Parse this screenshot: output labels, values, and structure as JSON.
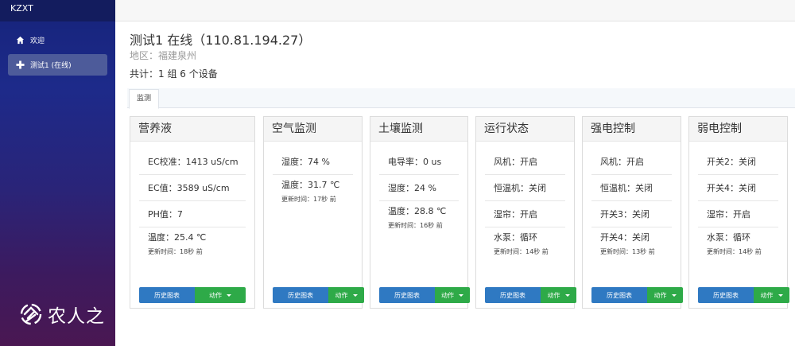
{
  "app": {
    "brand": "KZXT"
  },
  "sidebar": {
    "items": [
      {
        "label": "欢迎",
        "icon": "home-icon"
      },
      {
        "label": "测试1 (在线)",
        "icon": "plus-icon",
        "active": true
      }
    ]
  },
  "watermark": {
    "text": "农人之"
  },
  "device": {
    "title": "测试1 在线（110.81.194.27）",
    "region": "地区：福建泉州",
    "summary": "共计：1 组 6 个设备"
  },
  "tabs": [
    {
      "label": "监测",
      "active": true
    }
  ],
  "cards": [
    {
      "title": "营养液",
      "rows": [
        "EC校准：1413 uS/cm",
        "EC值：3589 uS/cm",
        "PH值：7",
        "温度：25.4 ℃"
      ],
      "updated": "更新时间：18秒 前",
      "history_label": "历史图表",
      "action_label": "动作"
    },
    {
      "title": "空气监测",
      "rows": [
        "湿度：74 %",
        "温度：31.7 ℃"
      ],
      "updated": "更新时间：17秒 前",
      "history_label": "历史图表",
      "action_label": "动作"
    },
    {
      "title": "土壤监测",
      "rows": [
        "电导率：0 us",
        "湿度：24 %",
        "温度：28.8 ℃"
      ],
      "updated": "更新时间：16秒 前",
      "history_label": "历史图表",
      "action_label": "动作"
    },
    {
      "title": "运行状态",
      "rows": [
        "风机：开启",
        "恒温机：关闭",
        "湿帘：开启",
        "水泵：循环"
      ],
      "updated": "更新时间：14秒 前",
      "history_label": "历史图表",
      "action_label": "动作"
    },
    {
      "title": "强电控制",
      "rows": [
        "风机：开启",
        "恒温机：关闭",
        "开关3：关闭",
        "开关4：关闭"
      ],
      "updated": "更新时间：13秒 前",
      "history_label": "历史图表",
      "action_label": "动作"
    },
    {
      "title": "弱电控制",
      "rows": [
        "开关2：关闭",
        "开关4：关闭",
        "湿帘：开启",
        "水泵：循环"
      ],
      "updated": "更新时间：14秒 前",
      "history_label": "历史图表",
      "action_label": "动作"
    }
  ],
  "colors": {
    "sidebar_top": "#16237a",
    "sidebar_bottom": "#4a1752",
    "history_button": "#2f79c2",
    "action_button": "#2eaa48"
  }
}
